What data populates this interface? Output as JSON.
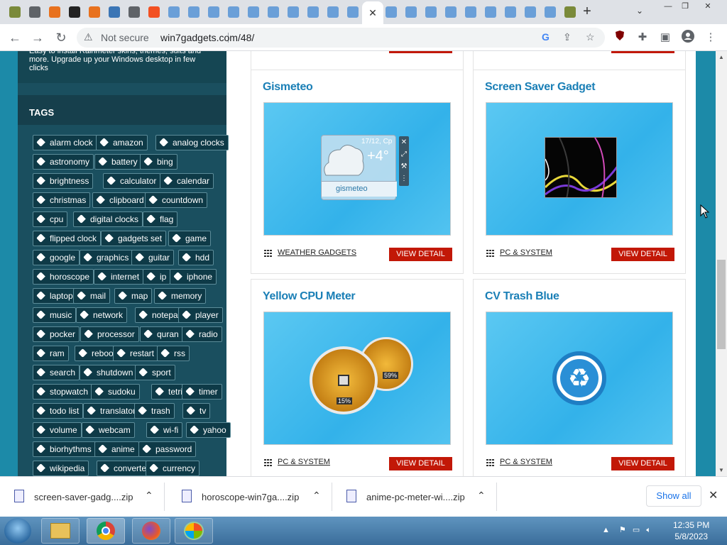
{
  "browser": {
    "tab_close": "✕",
    "new_tab": "+",
    "tab_search": "⌄",
    "window_buttons": [
      "—",
      "❐",
      "✕"
    ],
    "security_label": "Not secure",
    "url": "win7gadgets.com/48/"
  },
  "sidebar": {
    "intro_text": "Easy to install Rainmeter skins, themes, suits and more. Upgrade up your Windows desktop in few clicks",
    "tags_title": "TAGS",
    "tags": [
      [
        "alarm clock",
        "amazon",
        "analog clocks"
      ],
      [
        "astronomy",
        "battery",
        "bing"
      ],
      [
        "brightness",
        "calculator",
        "calendar"
      ],
      [
        "christmas",
        "clipboard",
        "countdown"
      ],
      [
        "cpu",
        "digital clocks",
        "flag"
      ],
      [
        "flipped clock",
        "gadgets set",
        "game"
      ],
      [
        "google",
        "graphics",
        "guitar",
        "hdd"
      ],
      [
        "horoscope",
        "internet",
        "ip",
        "iphone"
      ],
      [
        "laptop",
        "mail",
        "map",
        "memory"
      ],
      [
        "music",
        "network",
        "notepad",
        "player"
      ],
      [
        "pocker",
        "processor",
        "quran",
        "radio"
      ],
      [
        "ram",
        "reboot",
        "restart",
        "rss"
      ],
      [
        "search",
        "shutdown",
        "sport"
      ],
      [
        "stopwatch",
        "sudoku",
        "tetris",
        "timer"
      ],
      [
        "todo list",
        "translator",
        "trash",
        "tv"
      ],
      [
        "volume",
        "webcam",
        "wi-fi",
        "yahoo"
      ],
      [
        "biorhythms",
        "anime",
        "password"
      ],
      [
        "wikipedia",
        "converter",
        "currency"
      ]
    ]
  },
  "cards": [
    {
      "title": "Gismeteo",
      "category": "WEATHER GADGETS",
      "button": "VIEW DETAIL",
      "widget_date": "17/12, Ср",
      "widget_temp": "+4°",
      "widget_brand": "gismeteo"
    },
    {
      "title": "Screen Saver Gadget",
      "category": "PC & SYSTEM",
      "button": "VIEW DETAIL"
    },
    {
      "title": "Yellow CPU Meter",
      "category": "PC & SYSTEM",
      "button": "VIEW DETAIL",
      "meter_cpu": "15%",
      "meter_mem": "59%"
    },
    {
      "title": "CV Trash Blue",
      "category": "PC & SYSTEM",
      "button": "VIEW DETAIL"
    }
  ],
  "downloads": {
    "items": [
      {
        "name": "screen-saver-gadg....zip"
      },
      {
        "name": "horoscope-win7ga....zip"
      },
      {
        "name": "anime-pc-meter-wi....zip"
      }
    ],
    "show_all": "Show all",
    "close": "✕"
  },
  "taskbar": {
    "time": "12:35 PM",
    "date": "5/8/2023"
  }
}
